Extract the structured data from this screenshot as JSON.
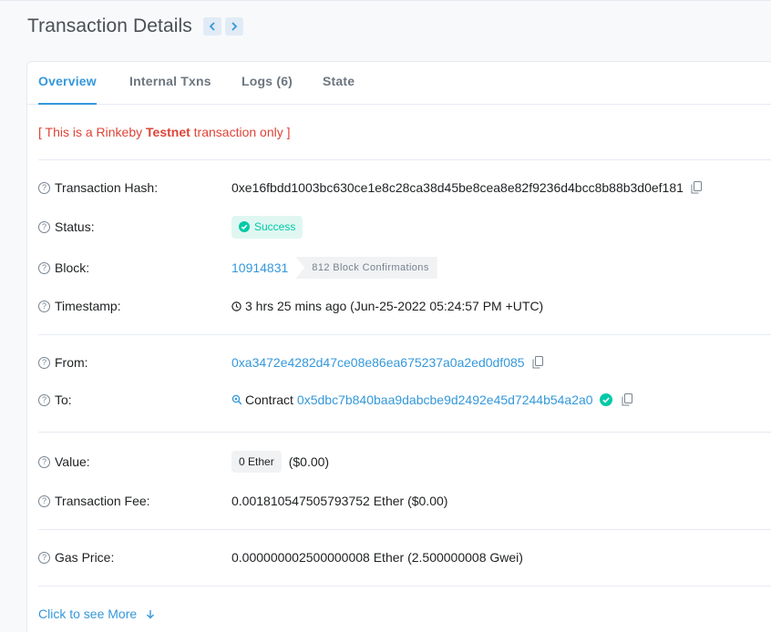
{
  "header": {
    "title": "Transaction Details",
    "prev_icon": "chevron-left-icon",
    "next_icon": "chevron-right-icon"
  },
  "tabs": [
    {
      "label": "Overview",
      "active": true
    },
    {
      "label": "Internal Txns",
      "active": false
    },
    {
      "label": "Logs (6)",
      "active": false
    },
    {
      "label": "State",
      "active": false
    }
  ],
  "notice": {
    "prefix": "[ This is a Rinkeby ",
    "bold": "Testnet",
    "suffix": " transaction only ]"
  },
  "fields": {
    "tx_hash": {
      "label": "Transaction Hash:",
      "value": "0xe16fbdd1003bc630ce1e8c28ca38d45be8cea8e82f9236d4bcc8b88b3d0ef181"
    },
    "status": {
      "label": "Status:",
      "value": "Success"
    },
    "block": {
      "label": "Block:",
      "value": "10914831",
      "confirmations": "812 Block Confirmations"
    },
    "timestamp": {
      "label": "Timestamp:",
      "value": "3 hrs 25 mins ago (Jun-25-2022 05:24:57 PM +UTC)"
    },
    "from": {
      "label": "From:",
      "value": "0xa3472e4282d47ce08e86ea675237a0a2ed0df085"
    },
    "to": {
      "label": "To:",
      "prefix": "Contract",
      "value": "0x5dbc7b840baa9dabcbe9d2492e45d7244b54a2a0"
    },
    "value": {
      "label": "Value:",
      "amount": "0 Ether",
      "usd": "($0.00)"
    },
    "fee": {
      "label": "Transaction Fee:",
      "value": "0.001810547505793752 Ether ($0.00)"
    },
    "gas": {
      "label": "Gas Price:",
      "value": "0.000000002500000008 Ether (2.500000008 Gwei)"
    }
  },
  "more_link": "Click to see More",
  "colors": {
    "accent": "#3498db",
    "success": "#00c9a7",
    "danger": "#de4437"
  }
}
